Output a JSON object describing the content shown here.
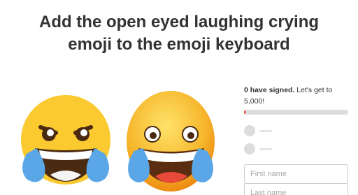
{
  "petition": {
    "title_line1": "Add the open eyed laughing crying",
    "title_line2": "emoji to the emoji keyboard"
  },
  "image": {
    "left_emoji": "grinning-face-with-tears-of-joy-icon",
    "right_emoji": "laughing-crying-face-icon",
    "colors": {
      "face_yellow": "#fbc930",
      "face_orange": "#f39a1a",
      "tear_blue": "#5aa6e6",
      "mouth_brown": "#4a2a10"
    }
  },
  "sidebar": {
    "signed_count": "0 have signed.",
    "signed_cta": "Let's get to 5,000!",
    "progress_fraction": 0.01,
    "colors": {
      "progress": "#ec2c22",
      "track": "#dddddd"
    }
  },
  "form": {
    "first_name_placeholder": "First name",
    "last_name_placeholder": "Last name"
  }
}
